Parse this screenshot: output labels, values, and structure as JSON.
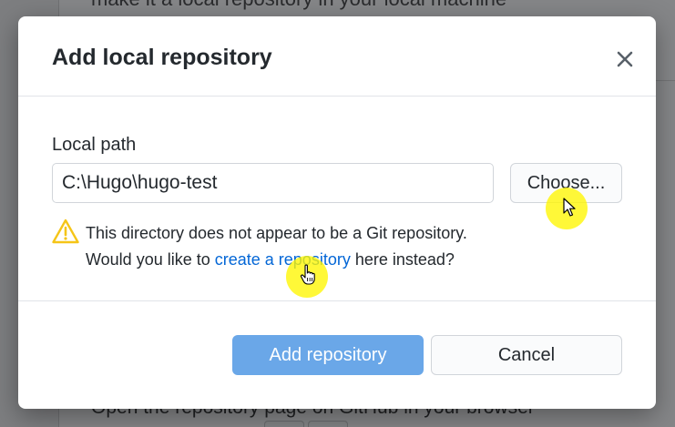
{
  "background": {
    "top_text": "make it a local repository in your local machine",
    "bottom_text": "Open the repository page on GitHub in your browser"
  },
  "dialog": {
    "title": "Add local repository",
    "close_icon": "close-icon",
    "local_path_label": "Local path",
    "local_path_value": "C:\\Hugo\\hugo-test",
    "choose_button": "Choose...",
    "warning_icon": "warning-triangle-icon",
    "warning_line1": "This directory does not appear to be a Git repository.",
    "warning_line2_prefix": "Would you like to ",
    "warning_link": "create a repository",
    "warning_line2_suffix": " here instead?",
    "add_button": "Add repository",
    "cancel_button": "Cancel"
  },
  "colors": {
    "accent": "#0366d6",
    "primary_button": "#6aa7e8",
    "warning": "#f5c518",
    "highlight": "#fff600"
  }
}
